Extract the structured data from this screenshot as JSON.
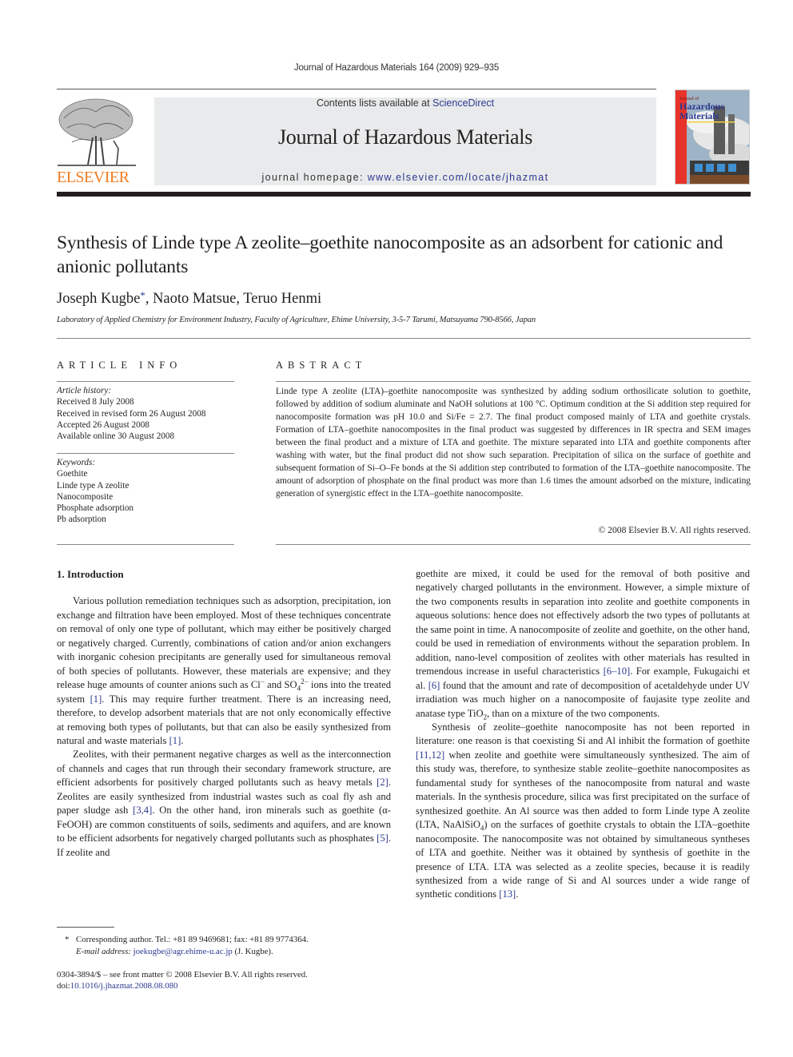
{
  "running_head": "Journal of Hazardous Materials 164 (2009) 929–935",
  "masthead": {
    "contents_prefix": "Contents lists available at ",
    "contents_link": "ScienceDirect",
    "journal_title": "Journal of Hazardous Materials",
    "homepage_prefix": "journal homepage: ",
    "homepage_link": "www.elsevier.com/locate/jhazmat",
    "publisher_logo_text": "ELSEVIER",
    "cover": {
      "line1": "Journal of",
      "line2": "Hazardous",
      "line3": "Materials"
    },
    "colors": {
      "publisher_orange": "#f47b20",
      "link_blue": "#2b3990",
      "cover_red": "#e8332a"
    }
  },
  "article": {
    "title": "Synthesis of Linde type A zeolite–goethite nanocomposite as an adsorbent for cationic and anionic pollutants",
    "authors": [
      {
        "name": "Joseph Kugbe",
        "mark": "*"
      },
      {
        "name": "Naoto Matsue",
        "mark": ""
      },
      {
        "name": "Teruo Henmi",
        "mark": ""
      }
    ],
    "affiliation": "Laboratory of Applied Chemistry for Environment Industry, Faculty of Agriculture, Ehime University, 3-5-7 Tarumi, Matsuyama 790-8566, Japan"
  },
  "article_info": {
    "heading": "ARTICLE INFO",
    "history_label": "Article history:",
    "history": [
      "Received 8 July 2008",
      "Received in revised form 26 August 2008",
      "Accepted 26 August 2008",
      "Available online 30 August 2008"
    ],
    "keywords_label": "Keywords:",
    "keywords": [
      "Goethite",
      "Linde type A zeolite",
      "Nanocomposite",
      "Phosphate adsorption",
      "Pb adsorption"
    ]
  },
  "abstract": {
    "heading": "ABSTRACT",
    "text_part1": "Linde type A zeolite (LTA)–goethite nanocomposite was synthesized by adding sodium orthosilicate solution to goethite, followed by addition of sodium aluminate and NaOH solutions at 100 °C. Optimum condition at the Si addition step required for nanocomposite formation was pH 10.0 and Si/Fe = 2.7. The final product composed mainly of LTA and goethite crystals. Formation of LTA–goethite nanocomposites in the final product was suggested by differences in IR spectra and SEM images between the final product and a mixture of LTA and goethite. The mixture separated into LTA and goethite components after washing with water, but the final product did not show such separation. Precipitation of silica on the surface of goethite and subsequent formation of Si–O–Fe bonds at the Si addition step contributed to formation of the LTA–goethite nanocomposite. The amount of adsorption of phosphate on the final product was more than 1.6 times the amount adsorbed on the mixture, indicating generation of synergistic effect in the LTA–goethite nanocomposite.",
    "copyright": "© 2008 Elsevier B.V. All rights reserved."
  },
  "body": {
    "section_heading": "1.  Introduction",
    "left_p1": {
      "a": "Various pollution remediation techniques such as adsorption, precipitation, ion exchange and filtration have been employed. Most of these techniques concentrate on removal of only one type of pollutant, which may either be positively charged or negatively charged. Currently, combinations of cation and/or anion exchangers with inorganic cohesion precipitants are generally used for simultaneous removal of both species of pollutants. However, these materials are expensive; and they release huge amounts of counter anions such as Cl",
      "cl_sup": "−",
      "b": " and SO",
      "so4_sub": "4",
      "so4_sup": "2−",
      "c": " ions into the treated system ",
      "ref1": "[1]",
      "d": ". This may require further treatment. There is an increasing need, therefore, to develop adsorbent materials that are not only economically effective at removing both types of pollutants, but that can also be easily synthesized from natural and waste materials ",
      "ref2": "[1]",
      "e": "."
    },
    "left_p2": {
      "a": "Zeolites, with their permanent negative charges as well as the interconnection of channels and cages that run through their secondary framework structure, are efficient adsorbents for positively charged pollutants such as heavy metals ",
      "ref1": "[2]",
      "b": ". Zeolites are easily synthesized from industrial wastes such as coal fly ash and paper sludge ash ",
      "ref2": "[3,4]",
      "c": ". On the other hand, iron minerals such as goethite (α-FeOOH) are common constituents of soils, sediments and aquifers, and are known to be efficient adsorbents for negatively charged pollutants such as phosphates ",
      "ref3": "[5]",
      "d": ". If zeolite and"
    },
    "right_p1": {
      "a": "goethite are mixed, it could be used for the removal of both positive and negatively charged pollutants in the environment. However, a simple mixture of the two components results in separation into zeolite and goethite components in aqueous solutions: hence does not effectively adsorb the two types of pollutants at the same point in time. A nanocomposite of zeolite and goethite, on the other hand, could be used in remediation of environments without the separation problem. In addition, nano-level composition of zeolites with other materials has resulted in tremendous increase in useful characteristics ",
      "ref1": "[6–10]",
      "b": ". For example, Fukugaichi et al. ",
      "ref2": "[6]",
      "c": " found that the amount and rate of decomposition of acetaldehyde under UV irradiation was much higher on a nanocomposite of faujasite type zeolite and anatase type TiO",
      "tio2_sub": "2",
      "d": ", than on a mixture of the two components."
    },
    "right_p2": {
      "a": "Synthesis of zeolite–goethite nanocomposite has not been reported in literature: one reason is that coexisting Si and Al inhibit the formation of goethite ",
      "ref1": "[11,12]",
      "b": " when zeolite and goethite were simultaneously synthesized. The aim of this study was, therefore, to synthesize stable zeolite–goethite nanocomposites as fundamental study for syntheses of the nanocomposite from natural and waste materials. In the synthesis procedure, silica was first precipitated on the surface of synthesized goethite. An Al source was then added to form Linde type A zeolite (LTA, NaAlSiO",
      "sub4": "4",
      "c": ") on the surfaces of goethite crystals to obtain the LTA–goethite nanocomposite. The nanocomposite was not obtained by simultaneous syntheses of LTA and goethite. Neither was it obtained by synthesis of goethite in the presence of LTA. LTA was selected as a zeolite species, because it is readily synthesized from a wide range of Si and Al sources under a wide range of synthetic conditions ",
      "ref2": "[13]",
      "d": "."
    }
  },
  "footnote": {
    "mark": "*",
    "text": "Corresponding author. Tel.: +81 89 9469681; fax: +81 89 9774364.",
    "email_label": "E-mail address:",
    "email": "joekugbe@agr.ehime-u.ac.jp",
    "email_suffix": " (J. Kugbe)."
  },
  "issn_line": "0304-3894/$ – see front matter © 2008 Elsevier B.V. All rights reserved.",
  "doi": {
    "prefix": "doi:",
    "value": "10.1016/j.jhazmat.2008.08.080"
  }
}
